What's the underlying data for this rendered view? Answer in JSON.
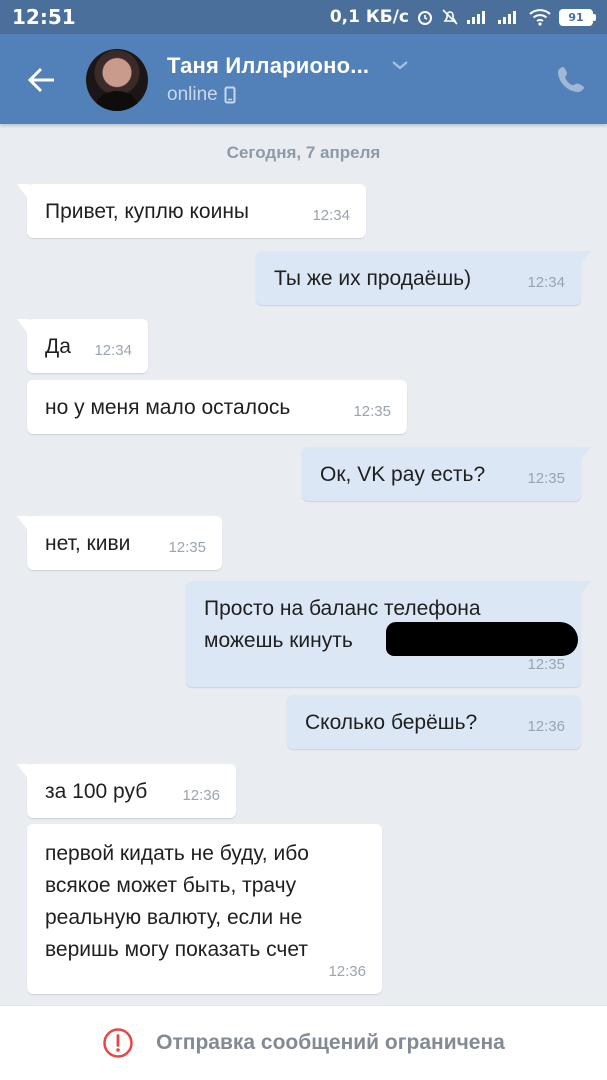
{
  "status_bar": {
    "time": "12:51",
    "network_speed": "0,1 КБ/с",
    "battery": "91",
    "icons": [
      "alarm-icon",
      "mute-icon",
      "signal-icon",
      "signal-icon",
      "wifi-icon",
      "battery-icon"
    ]
  },
  "header": {
    "contact_name": "Таня Илларионо...",
    "status": "online",
    "back_icon": "back-arrow-icon",
    "call_icon": "phone-icon",
    "accent_color": "#5181b8"
  },
  "date_separator": "Сегодня, 7 апреля",
  "messages": [
    {
      "dir": "in",
      "text": "Привет, куплю коины",
      "time": "12:34"
    },
    {
      "dir": "out",
      "text": "Ты же их продаёшь)",
      "time": "12:34"
    },
    {
      "dir": "in",
      "text": "Да",
      "time": "12:34"
    },
    {
      "dir": "in",
      "text": "но у меня мало осталось",
      "time": "12:35"
    },
    {
      "dir": "out",
      "text": "Ок, VK pay есть?",
      "time": "12:35"
    },
    {
      "dir": "in",
      "text": "нет, киви",
      "time": "12:35"
    },
    {
      "dir": "out",
      "text": "Просто на баланс телефона\nможешь кинуть",
      "time": "12:35"
    },
    {
      "dir": "out",
      "text": "Сколько берёшь?",
      "time": "12:36"
    },
    {
      "dir": "in",
      "text": "за 100 руб",
      "time": "12:36"
    },
    {
      "dir": "in",
      "text": "первой кидать не буду, ибо\nвсякое может быть, трачу\nреальную валюту, если не\nверишь могу показать счет",
      "time": "12:36"
    }
  ],
  "footer": {
    "text": "Отправка сообщений ограничена",
    "icon": "warning-circle-icon"
  }
}
